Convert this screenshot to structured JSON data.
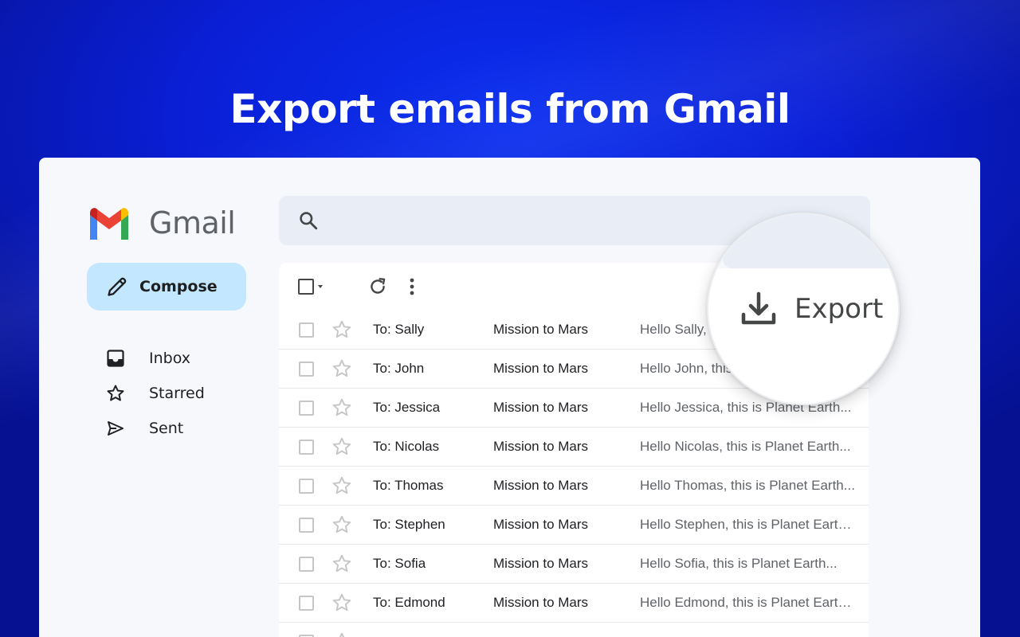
{
  "headline": "Export emails from Gmail",
  "app": {
    "logo_text": "Gmail",
    "colors": {
      "blue": "#4285F4",
      "red": "#EA4335",
      "yellow": "#FBBC04",
      "green": "#34A853",
      "dark_red": "#C5221F"
    }
  },
  "compose": {
    "label": "Compose",
    "icon": "pencil-icon"
  },
  "sidebar": {
    "items": [
      {
        "label": "Inbox",
        "icon": "inbox-icon"
      },
      {
        "label": "Starred",
        "icon": "star-icon"
      },
      {
        "label": "Sent",
        "icon": "send-icon"
      }
    ]
  },
  "search": {
    "placeholder": "",
    "icon": "search-icon"
  },
  "toolbar": {
    "icons": [
      "select-all-checkbox",
      "refresh-icon",
      "more-vert-icon"
    ]
  },
  "emails": [
    {
      "to": "To: Sally",
      "subject": "Mission to Mars",
      "snippet": "Hello Sally, this is Planet Earth..."
    },
    {
      "to": "To: John",
      "subject": "Mission to Mars",
      "snippet": "Hello John, this is Planet Earth..."
    },
    {
      "to": "To: Jessica",
      "subject": "Mission to Mars",
      "snippet": "Hello Jessica, this is Planet Earth..."
    },
    {
      "to": "To: Nicolas",
      "subject": "Mission to Mars",
      "snippet": "Hello Nicolas, this is Planet Earth..."
    },
    {
      "to": "To: Thomas",
      "subject": "Mission to Mars",
      "snippet": "Hello Thomas, this is Planet Earth..."
    },
    {
      "to": "To: Stephen",
      "subject": "Mission to Mars",
      "snippet": "Hello Stephen, this is Planet Earth..."
    },
    {
      "to": "To: Sofia",
      "subject": "Mission to Mars",
      "snippet": "Hello Sofia, this is Planet Earth..."
    },
    {
      "to": "To: Edmond",
      "subject": "Mission to Mars",
      "snippet": "Hello Edmond, this is Planet Earth..."
    }
  ],
  "export": {
    "label": "Export",
    "icon": "download-icon"
  }
}
